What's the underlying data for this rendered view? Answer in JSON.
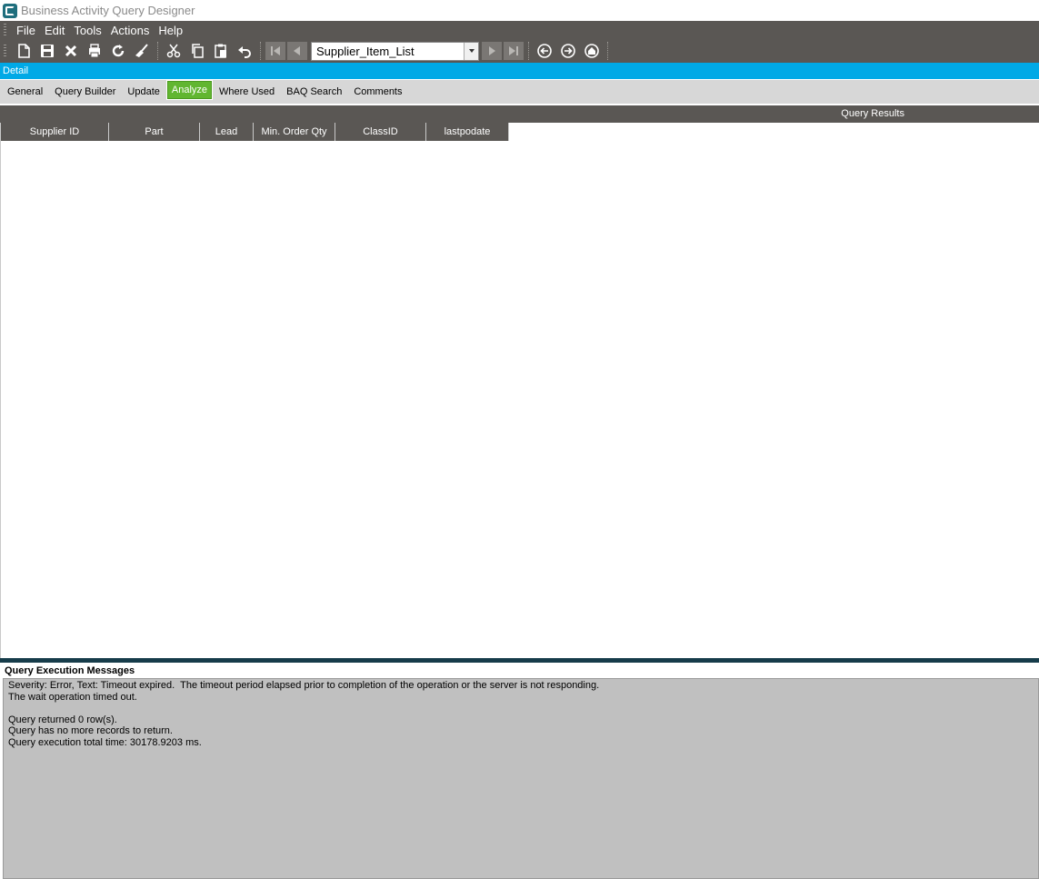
{
  "window": {
    "title": "Business Activity Query Designer"
  },
  "menu": {
    "items": [
      "File",
      "Edit",
      "Tools",
      "Actions",
      "Help"
    ]
  },
  "toolbar": {
    "record_select_value": "Supplier_Item_List",
    "icons": [
      "new-icon",
      "save-icon",
      "delete-icon",
      "print-icon",
      "refresh-icon",
      "clear-icon",
      "cut-icon",
      "copy-icon",
      "paste-icon",
      "undo-icon",
      "first-record-icon",
      "previous-record-icon",
      "next-record-icon",
      "last-record-icon",
      "back-icon",
      "forward-icon",
      "home-icon"
    ]
  },
  "detail_bar": {
    "label": "Detail"
  },
  "tabs": {
    "items": [
      "General",
      "Query Builder",
      "Update",
      "Analyze",
      "Where Used",
      "BAQ Search",
      "Comments"
    ],
    "active": "Analyze"
  },
  "results": {
    "header": "Query Results",
    "columns": [
      "Supplier ID",
      "Part",
      "Lead",
      "Min. Order Qty",
      "ClassID",
      "lastpodate"
    ],
    "rows": []
  },
  "messages": {
    "header": "Query Execution Messages",
    "lines": [
      "Severity: Error, Text: Timeout expired.  The timeout period elapsed prior to completion of the operation or the server is not responding.",
      "The wait operation timed out.",
      "",
      "Query returned 0 row(s).",
      "Query has no more records to return.",
      "Query execution total time: 30178.9203 ms."
    ]
  },
  "colors": {
    "toolbar_bg": "#5a5754",
    "detail_bar": "#00a9e6",
    "active_tab": "#61b630",
    "messages_bg": "#c0c0c0"
  }
}
